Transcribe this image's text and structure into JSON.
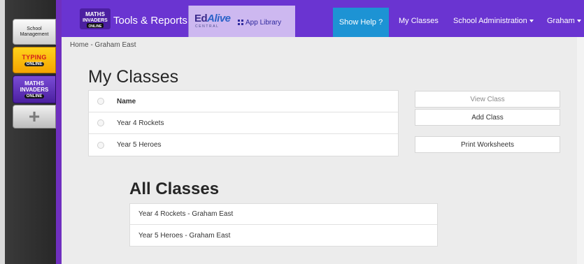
{
  "sidebar": {
    "tiles": [
      {
        "name": "school-management",
        "line1": "School",
        "line2": "Management"
      },
      {
        "name": "typing",
        "line1": "TYPING",
        "line2": "ONLINE"
      },
      {
        "name": "invaders",
        "line1": "MATHS INVADERS",
        "line2": "ONLINE"
      },
      {
        "name": "add",
        "label": "+"
      }
    ]
  },
  "header": {
    "brand_title": "Tools & Reports",
    "edalive_logo_a": "Ed",
    "edalive_logo_b": "Alive",
    "edalive_sub": "CENTRAL",
    "app_library_label": "App Library",
    "show_help_label": "Show Help ?",
    "nav_classes": "My Classes",
    "nav_admin": "School Administration",
    "nav_user": "Graham"
  },
  "breadcrumb": "Home - Graham East",
  "my_classes": {
    "title": "My Classes",
    "column_name": "Name",
    "rows": [
      "Year 4 Rockets",
      "Year 5 Heroes"
    ]
  },
  "actions": {
    "view_class": "View Class",
    "add_class": "Add Class",
    "print_worksheets": "Print Worksheets"
  },
  "all_classes": {
    "title": "All Classes",
    "rows": [
      "Year 4 Rockets - Graham East",
      "Year 5 Heroes - Graham East"
    ]
  },
  "colors": {
    "nav_purple": "#6a34d1",
    "help_blue": "#1d93d4",
    "library_lilac": "#cdb8f0"
  }
}
